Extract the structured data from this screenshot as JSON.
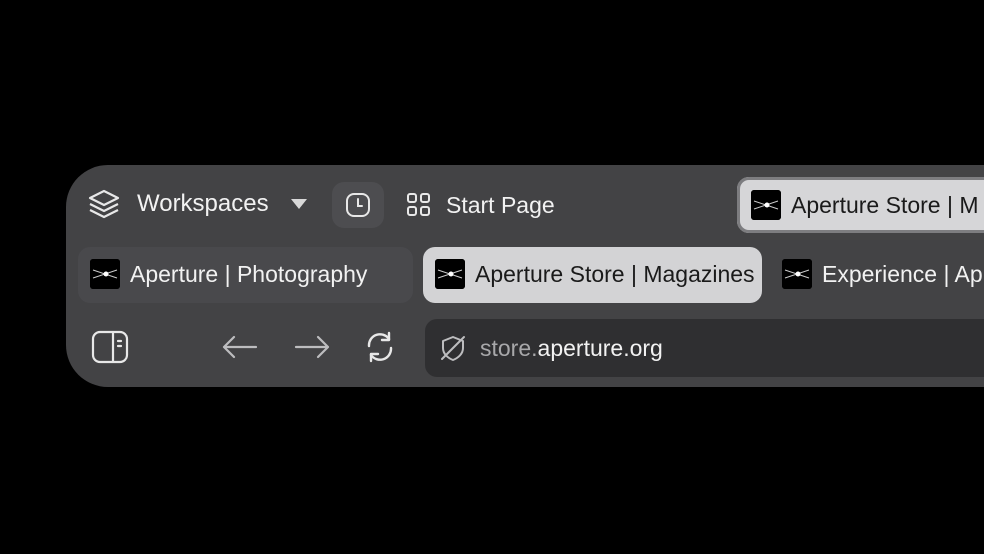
{
  "toolbar": {
    "workspaces_label": "Workspaces",
    "start_page_label": "Start Page",
    "pinned_tab_label": "Aperture Store | M"
  },
  "tabs": [
    {
      "label": "Aperture | Photography"
    },
    {
      "label": "Aperture Store | Magazines"
    },
    {
      "label": "Experience | Ap"
    }
  ],
  "address_bar": {
    "subdomain": "store.",
    "domain": "aperture.org"
  },
  "icons": {
    "workspaces": "layers-icon",
    "caret": "caret-down-icon",
    "history": "clock-icon",
    "start_page": "grid-icon",
    "sidebar": "sidebar-toggle-icon",
    "back": "arrow-left-icon",
    "forward": "arrow-right-icon",
    "reload": "reload-icon",
    "security": "shield-slash-icon"
  },
  "colors": {
    "window_bg": "#434345",
    "active_tab_bg": "#d3d3d5",
    "address_bg": "#2f2f31"
  }
}
